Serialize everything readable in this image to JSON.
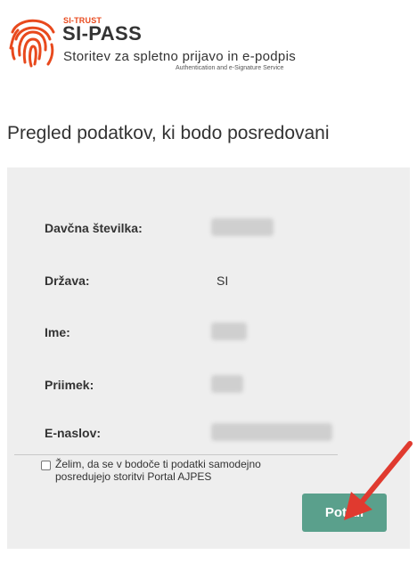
{
  "header": {
    "org_small": "SI-TRUST",
    "brand": "SI-PASS",
    "subtitle": "Storitev za spletno prijavo in e-podpis",
    "subtitle_en": "Authentication and e-Signature Service"
  },
  "page": {
    "title": "Pregled podatkov, ki bodo posredovani"
  },
  "fields": [
    {
      "label": "Davčna številka:",
      "value": ""
    },
    {
      "label": "Država:",
      "value": "SI"
    },
    {
      "label": "Ime:",
      "value": ""
    },
    {
      "label": "Priimek:",
      "value": ""
    },
    {
      "label": "E-naslov:",
      "value": ""
    }
  ],
  "consent": {
    "label": "Želim, da se v bodoče ti podatki samodejno posredujejo storitvi Portal AJPES",
    "checked": false
  },
  "actions": {
    "confirm_label": "Potrdi"
  },
  "colors": {
    "brand_orange": "#e8491d",
    "button_green": "#5aa08c",
    "arrow_red": "#e03a2f",
    "panel_bg": "#eeeeee"
  },
  "icons": {
    "logo": "fingerprint-icon",
    "annotation": "arrow-icon"
  }
}
